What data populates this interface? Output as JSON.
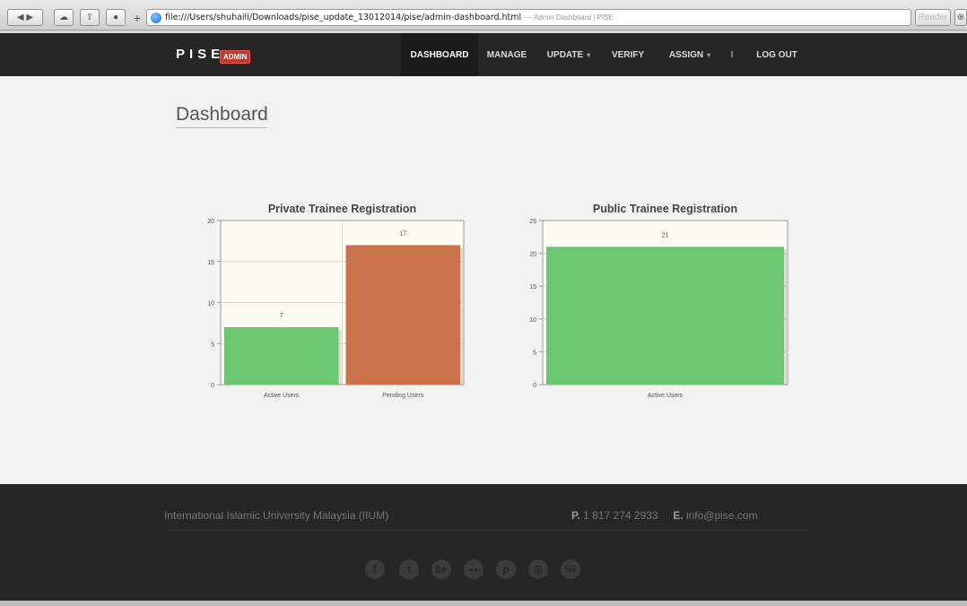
{
  "browser": {
    "url": "file:///Users/shuhaili/Downloads/pise_update_13012014/pise/admin-dashboard.html",
    "page_title": "— Admin Dashboard | PISE",
    "reader_label": "Reader"
  },
  "navbar": {
    "brand": "PISE",
    "badge": "ADMIN",
    "items": [
      {
        "label": "DASHBOARD"
      },
      {
        "label": "MANAGE"
      },
      {
        "label": "UPDATE"
      },
      {
        "label": "VERIFY"
      },
      {
        "label": "ASSIGN"
      },
      {
        "label": "I"
      },
      {
        "label": "LOG OUT"
      }
    ]
  },
  "page": {
    "title": "Dashboard"
  },
  "chart_data": [
    {
      "type": "bar",
      "title": "Private Trainee Registration",
      "categories": [
        "Active Users",
        "Pending Users"
      ],
      "values": [
        7,
        17
      ],
      "colors": [
        "#6cc870",
        "#c8734a"
      ],
      "ylim": [
        0,
        20
      ],
      "yticks": [
        0,
        5,
        10,
        15,
        20
      ],
      "grid": true
    },
    {
      "type": "bar",
      "title": "Public Trainee Registration",
      "categories": [
        "Active Users"
      ],
      "values": [
        21
      ],
      "colors": [
        "#6cc870"
      ],
      "ylim": [
        0,
        25
      ],
      "yticks": [
        0,
        5,
        10,
        15,
        20,
        25
      ],
      "grid": true
    }
  ],
  "footer": {
    "org": "International Islamic University Malaysia (IIUM)",
    "phone_label": "P.",
    "phone": "1 817 274 2933",
    "email_label": "E.",
    "email": "info@pise.com",
    "social": [
      {
        "icon": "facebook-icon",
        "glyph": "f"
      },
      {
        "icon": "twitter-icon",
        "glyph": "t"
      },
      {
        "icon": "googleplus-icon",
        "glyph": "8+"
      },
      {
        "icon": "flickr-icon",
        "glyph": "●●"
      },
      {
        "icon": "pinterest-icon",
        "glyph": "p"
      },
      {
        "icon": "dribbble-icon",
        "glyph": "◎"
      },
      {
        "icon": "behance-icon",
        "glyph": "Bē"
      }
    ]
  }
}
